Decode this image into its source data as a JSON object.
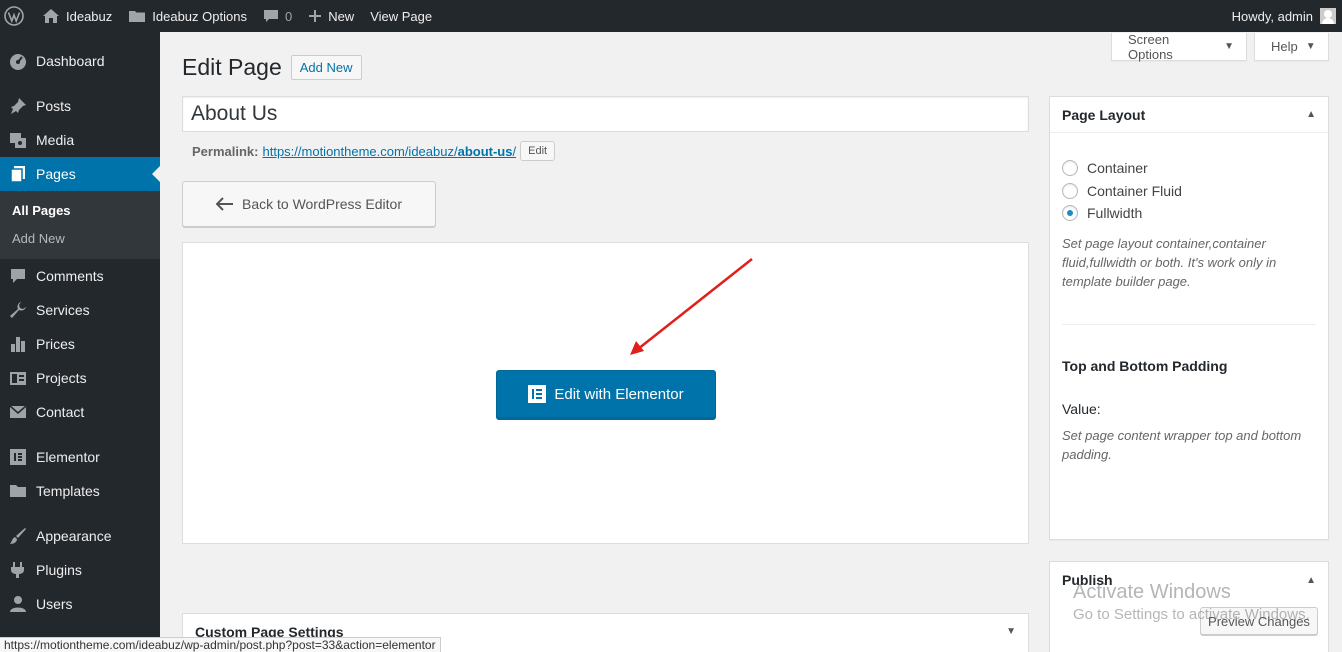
{
  "adminbar": {
    "site_name": "Ideabuz",
    "options": "Ideabuz Options",
    "comments_count": "0",
    "new_label": "New",
    "view_page": "View Page",
    "howdy": "Howdy, admin"
  },
  "sidebar": {
    "items": [
      {
        "label": "Dashboard",
        "icon": "dashboard-icon"
      },
      {
        "label": "Posts",
        "icon": "pin-icon"
      },
      {
        "label": "Media",
        "icon": "media-icon"
      },
      {
        "label": "Pages",
        "icon": "pages-icon"
      },
      {
        "label": "Comments",
        "icon": "comment-icon"
      },
      {
        "label": "Services",
        "icon": "wrench-icon"
      },
      {
        "label": "Prices",
        "icon": "bar-chart-icon"
      },
      {
        "label": "Projects",
        "icon": "portfolio-icon"
      },
      {
        "label": "Contact",
        "icon": "mail-icon"
      },
      {
        "label": "Elementor",
        "icon": "elementor-icon"
      },
      {
        "label": "Templates",
        "icon": "folder-icon"
      },
      {
        "label": "Appearance",
        "icon": "brush-icon"
      },
      {
        "label": "Plugins",
        "icon": "plugin-icon"
      },
      {
        "label": "Users",
        "icon": "user-icon"
      }
    ],
    "submenu": {
      "all_pages": "All Pages",
      "add_new": "Add New"
    }
  },
  "top_tabs": {
    "screen_options": "Screen Options",
    "help": "Help"
  },
  "heading": {
    "title": "Edit Page",
    "add_new": "Add New"
  },
  "post": {
    "title": "About Us",
    "permalink_label": "Permalink:",
    "permalink_base": "https://motiontheme.com/ideabuz/",
    "permalink_slug": "about-us",
    "permalink_trail": "/",
    "edit_label": "Edit"
  },
  "editor": {
    "back_button": "Back to WordPress Editor",
    "edit_with_elementor": "Edit with Elementor"
  },
  "custom_settings": {
    "title": "Custom Page Settings"
  },
  "page_layout": {
    "title": "Page Layout",
    "options": [
      "Container",
      "Container Fluid",
      "Fullwidth"
    ],
    "selected": "Fullwidth",
    "description": "Set page layout container,container fluid,fullwidth or both. It's work only in template builder page.",
    "padding_title": "Top and Bottom Padding",
    "value_label": "Value:",
    "padding_description": "Set page content wrapper top and bottom padding."
  },
  "publish": {
    "title": "Publish",
    "preview_button": "Preview Changes"
  },
  "watermark": {
    "line1": "Activate Windows",
    "line2": "Go to Settings to activate Windows."
  },
  "statusbar": {
    "url": "https://motiontheme.com/ideabuz/wp-admin/post.php?post=33&action=elementor"
  },
  "colors": {
    "accent": "#0073aa",
    "sidebar_bg": "#23282d",
    "arrow": "#e0201b"
  }
}
